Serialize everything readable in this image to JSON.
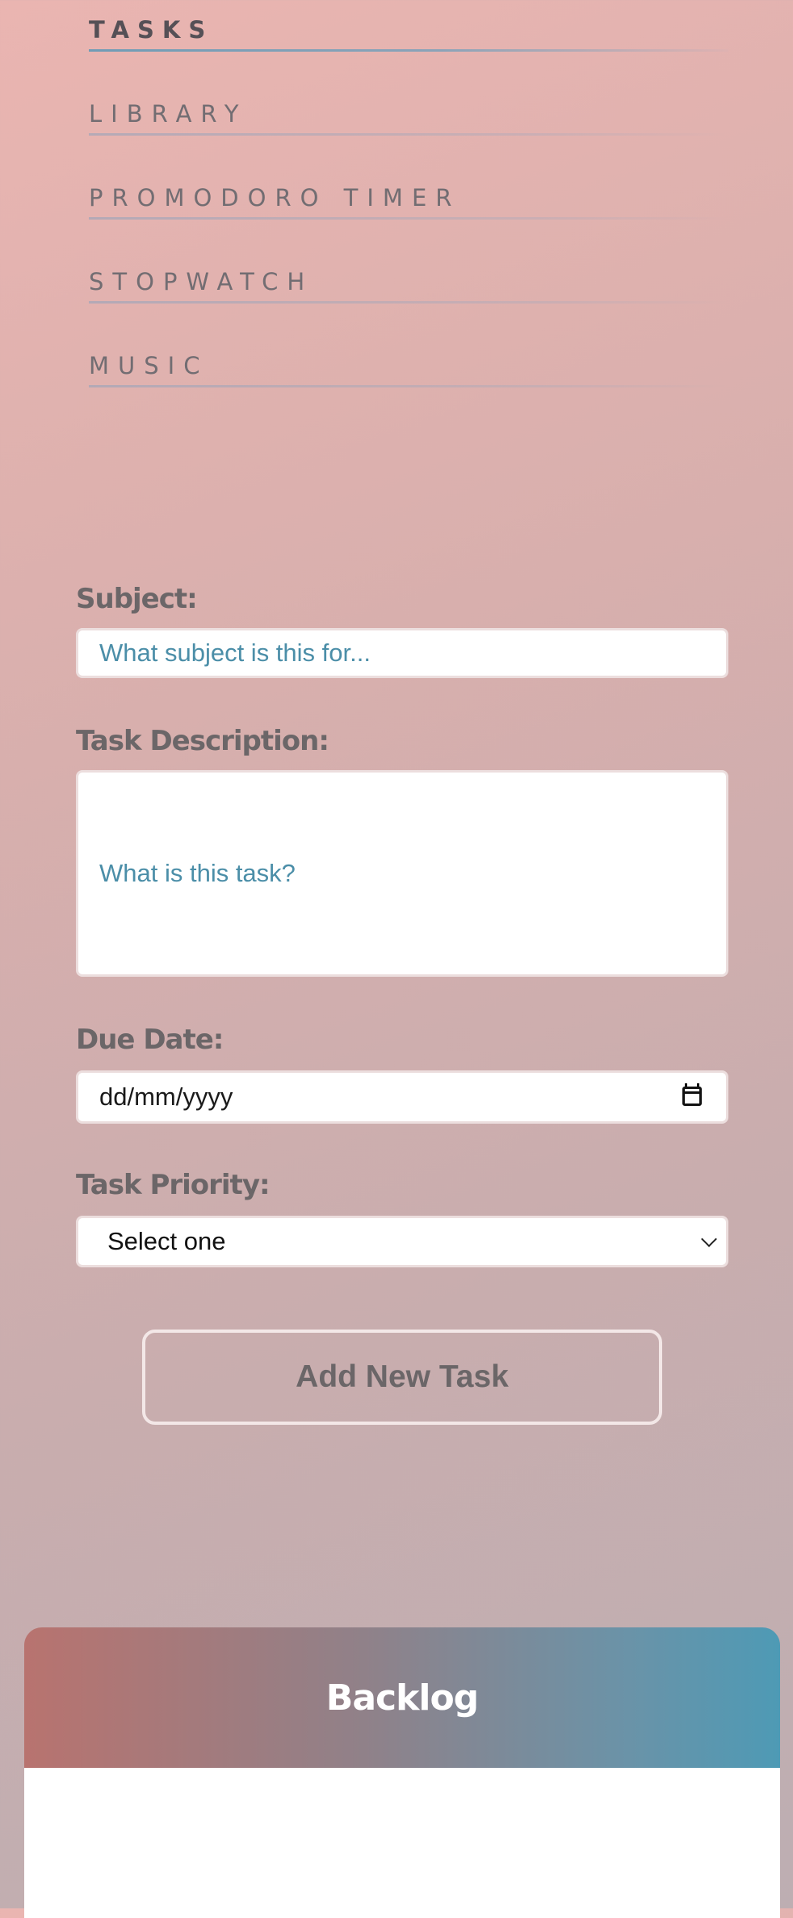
{
  "nav": {
    "items": [
      {
        "label": "TASKS",
        "active": true
      },
      {
        "label": "LIBRARY",
        "active": false
      },
      {
        "label": "PROMODORO TIMER",
        "active": false
      },
      {
        "label": "STOPWATCH",
        "active": false
      },
      {
        "label": "MUSIC",
        "active": false
      }
    ]
  },
  "form": {
    "subject": {
      "label": "Subject:",
      "placeholder": "What subject is this for..."
    },
    "description": {
      "label": "Task Description:",
      "placeholder": "What is this task?"
    },
    "due_date": {
      "label": "Due Date:",
      "value": "dd/mm/yyyy"
    },
    "priority": {
      "label": "Task Priority:",
      "selected": "Select one"
    },
    "submit_label": "Add New Task"
  },
  "backlog": {
    "title": "Backlog"
  },
  "colors": {
    "accent_blue": "#4b8ea8",
    "text_gray": "#6b6668",
    "backlog_gradient_start": "#b8736f",
    "backlog_gradient_end": "#4e9ab5"
  }
}
